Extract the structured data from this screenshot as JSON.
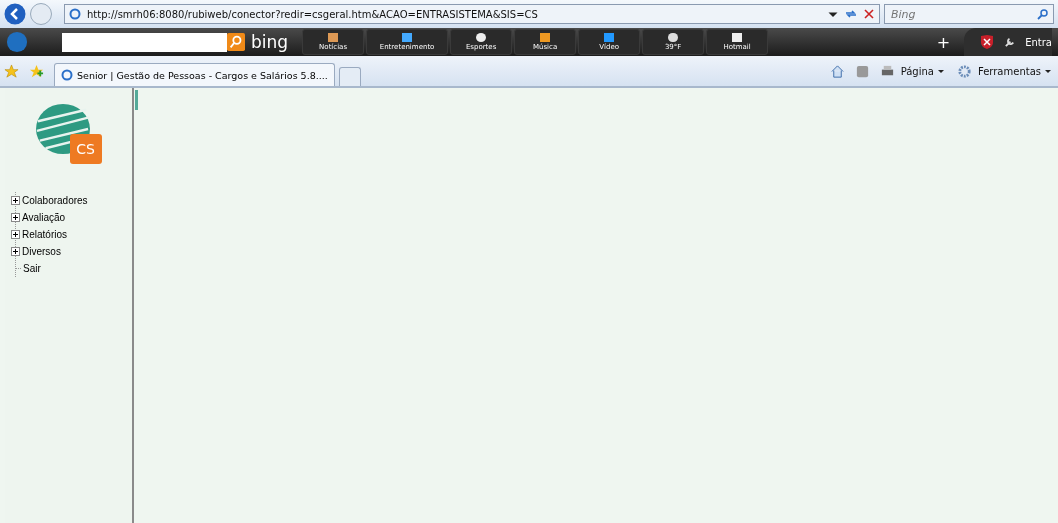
{
  "address_bar": {
    "url": "http://smrh06:8080/rubiweb/conector?redir=csgeral.htm&ACAO=ENTRASISTEMA&SIS=CS"
  },
  "search": {
    "placeholder": "Bing"
  },
  "hp_search": {
    "brand": "bing"
  },
  "hp_toolbar": {
    "buttons": [
      {
        "label": "Notícias"
      },
      {
        "label": "Entretenimento"
      },
      {
        "label": "Esportes"
      },
      {
        "label": "Música"
      },
      {
        "label": "Vídeo"
      },
      {
        "label": "39°F"
      },
      {
        "label": "Hotmail"
      }
    ],
    "plus": "+",
    "entrar": "Entra"
  },
  "tabs": [
    {
      "label": "Senior | Gestão de Pessoas - Cargos e Salários 5.8....",
      "selected": true
    }
  ],
  "command_bar": {
    "pagina": "Página",
    "ferramentas": "Ferramentas"
  },
  "logo": {
    "text": "CS"
  },
  "tree": [
    {
      "kind": "folder",
      "label": "Colaboradores",
      "expanded": false
    },
    {
      "kind": "folder",
      "label": "Avaliação",
      "expanded": false
    },
    {
      "kind": "folder",
      "label": "Relatórios",
      "expanded": false
    },
    {
      "kind": "folder",
      "label": "Diversos",
      "expanded": false
    },
    {
      "kind": "leaf",
      "label": "Sair"
    }
  ]
}
